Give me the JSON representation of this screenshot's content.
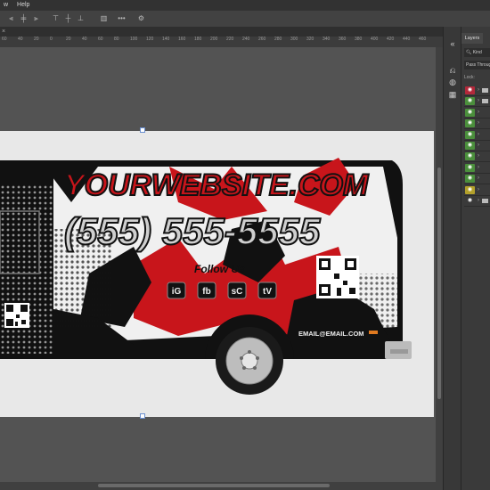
{
  "menubar": {
    "items": [
      "w",
      "Help"
    ]
  },
  "toolbar": {
    "icons": [
      "align-left-icon",
      "align-center-h-icon",
      "align-right-icon",
      "align-top-icon",
      "align-middle-icon",
      "align-bottom-icon",
      "distribute-icon",
      "more-icon",
      "settings-icon"
    ]
  },
  "ruler": {
    "ticks": [
      "60",
      "40",
      "20",
      "0",
      "20",
      "40",
      "60",
      "80",
      "100",
      "120",
      "140",
      "160",
      "180",
      "200",
      "220",
      "240",
      "260",
      "280",
      "300",
      "320",
      "340",
      "360",
      "380",
      "400",
      "420",
      "440",
      "460"
    ]
  },
  "panel": {
    "tab_label": "Layers",
    "filter_label": "Kind",
    "blend_mode": "Pass Through",
    "lock_label": "Lock:",
    "layer_eye_colors": [
      "#b3283a",
      "#4b8f3c",
      "#4b8f3c",
      "#4b8f3c",
      "#4b8f3c",
      "#4b8f3c",
      "#4b8f3c",
      "#4b8f3c",
      "#4b8f3c",
      "#b3a02a",
      "#3a3a3a"
    ]
  },
  "artwork": {
    "website": "YOURWEBSITE.COM",
    "phone": "(555) 555-5555",
    "follow": "Follow Us",
    "social": [
      "iG",
      "fb",
      "sC",
      "tV"
    ],
    "email": "EMAIL@EMAIL.COM",
    "colors": {
      "red": "#c8151b",
      "black": "#111111",
      "white": "#f2f2f2",
      "grey": "#6b6b6b"
    }
  }
}
